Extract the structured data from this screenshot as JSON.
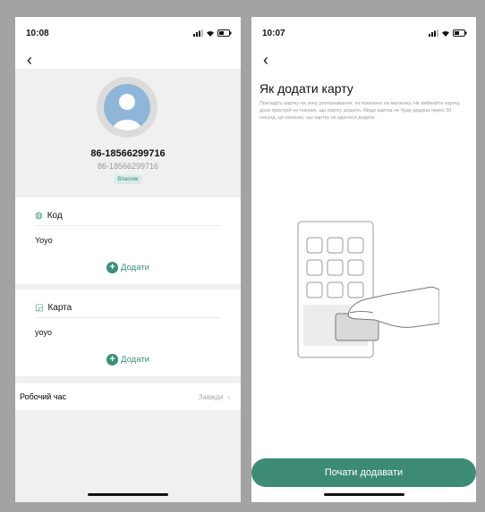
{
  "left": {
    "time": "10:08",
    "profile": {
      "name": "86-18566299716",
      "subname": "86-18566299716",
      "role": "Власник"
    },
    "code_card": {
      "title": "Код",
      "value": "Yoyo",
      "add_label": "Додати"
    },
    "card_card": {
      "title": "Карта",
      "value": "yoyo",
      "add_label": "Додати"
    },
    "work_time": {
      "label": "Робочий час",
      "value": "Завжди"
    }
  },
  "right": {
    "time": "10:07",
    "title": "Як додати карту",
    "description": "Покладіть картку на зону розпізнавання, як показано на малюнку. Не виймайте картку, доки пристрій не покаже, що картку додано. Якщо картка не буде додана через 30 секунд, це означає, що картку не вдалося додати.",
    "start_button": "Почати додавати"
  },
  "colors": {
    "accent": "#3a8f79",
    "button": "#3d8b74"
  }
}
